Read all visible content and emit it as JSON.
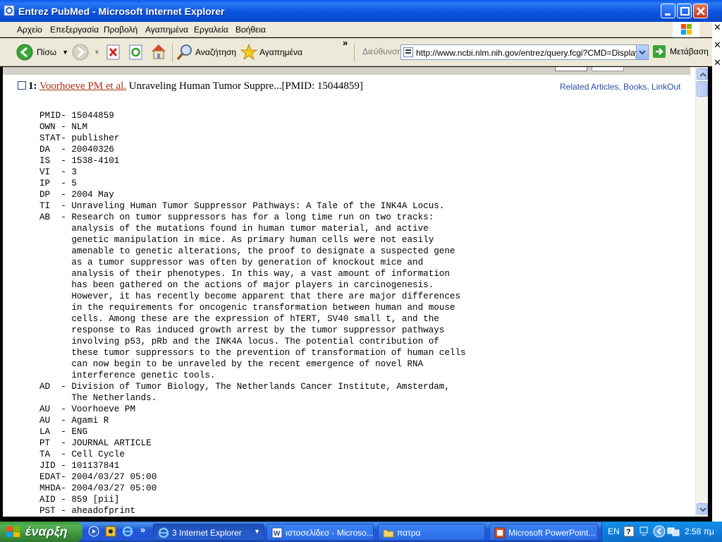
{
  "window": {
    "title": "Entrez PubMed - Microsoft Internet Explorer"
  },
  "menubar": {
    "items": [
      "Αρχείο",
      "Επεξεργασία",
      "Προβολή",
      "Αγαπημένα",
      "Εργαλεία",
      "Βοήθεια"
    ]
  },
  "toolbar": {
    "back_label": "Πίσω",
    "search_label": "Αναζήτηση",
    "favorites_label": "Αγαπημένα",
    "address_label": "Διεύθυνση",
    "address_value": "http://www.ncbi.nlm.nih.gov/entrez/query.fcgi?CMD=Display&DB=pubmed",
    "go_label": "Μετάβαση"
  },
  "result": {
    "number": "1:",
    "author_link": "Voorhoeve PM et al.",
    "title": "Unraveling Human Tumor Suppre...[PMID: 15044859]",
    "related": "Related Articles, Books, LinkOut"
  },
  "medline": [
    "PMID- 15044859",
    "OWN - NLM",
    "STAT- publisher",
    "DA  - 20040326",
    "IS  - 1538-4101",
    "VI  - 3",
    "IP  - 5",
    "DP  - 2004 May",
    "TI  - Unraveling Human Tumor Suppressor Pathways: A Tale of the INK4A Locus.",
    "AB  - Research on tumor suppressors has for a long time run on two tracks:",
    "      analysis of the mutations found in human tumor material, and active",
    "      genetic manipulation in mice. As primary human cells were not easily",
    "      amenable to genetic alterations, the proof to designate a suspected gene",
    "      as a tumor suppressor was often by generation of knockout mice and",
    "      analysis of their phenotypes. In this way, a vast amount of information",
    "      has been gathered on the actions of major players in carcinogenesis.",
    "      However, it has recently become apparent that there are major differences",
    "      in the requirements for oncogenic transformation between human and mouse",
    "      cells. Among these are the expression of hTERT, SV40 small t, and the",
    "      response to Ras induced growth arrest by the tumor suppressor pathways",
    "      involving p53, pRb and the INK4A locus. The potential contribution of",
    "      these tumor suppressors to the prevention of transformation of human cells",
    "      can now begin to be unraveled by the recent emergence of novel RNA",
    "      interference genetic tools.",
    "AD  - Division of Tumor Biology, The Netherlands Cancer Institute, Amsterdam,",
    "      The Netherlands.",
    "AU  - Voorhoeve PM",
    "AU  - Agami R",
    "LA  - ENG",
    "PT  - JOURNAL ARTICLE",
    "TA  - Cell Cycle",
    "JID - 101137841",
    "EDAT- 2004/03/27 05:00",
    "MHDA- 2004/03/27 05:00",
    "AID - 859 [pii]",
    "PST - aheadofprint"
  ],
  "taskbar": {
    "start_label": "έναρξη",
    "tasks": [
      "3 Internet Explorer",
      "ιστοσελίδεσ - Microso...",
      "πατρα",
      "Microsoft PowerPoint..."
    ],
    "lang": "EN",
    "clock": "2:58 πμ"
  },
  "colors": {
    "titlebar": "#0a5ae8",
    "link": "#b02c10",
    "related_link": "#2a4bb0",
    "start_green": "#3c9a3c"
  }
}
